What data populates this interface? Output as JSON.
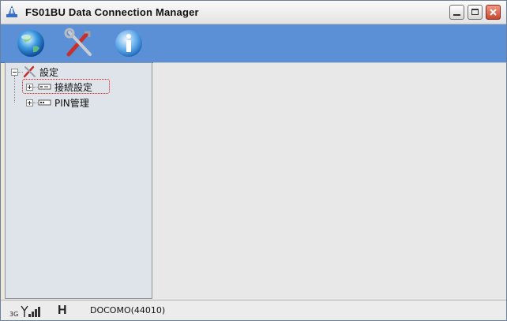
{
  "window": {
    "title": "FS01BU Data Connection Manager"
  },
  "toolbar": {
    "buttons": [
      {
        "icon": "globe-icon"
      },
      {
        "icon": "tools-icon"
      },
      {
        "icon": "info-icon"
      }
    ]
  },
  "tree": {
    "root": "設定",
    "children": [
      {
        "label": "接続設定",
        "icon": "connection-icon"
      },
      {
        "label": "PIN管理",
        "icon": "pin-icon"
      }
    ]
  },
  "status": {
    "network": "3G",
    "mode": "H",
    "carrier": "DOCOMO(44010)"
  },
  "colors": {
    "toolbar": "#5b8fd6",
    "focus": "#d11111"
  }
}
